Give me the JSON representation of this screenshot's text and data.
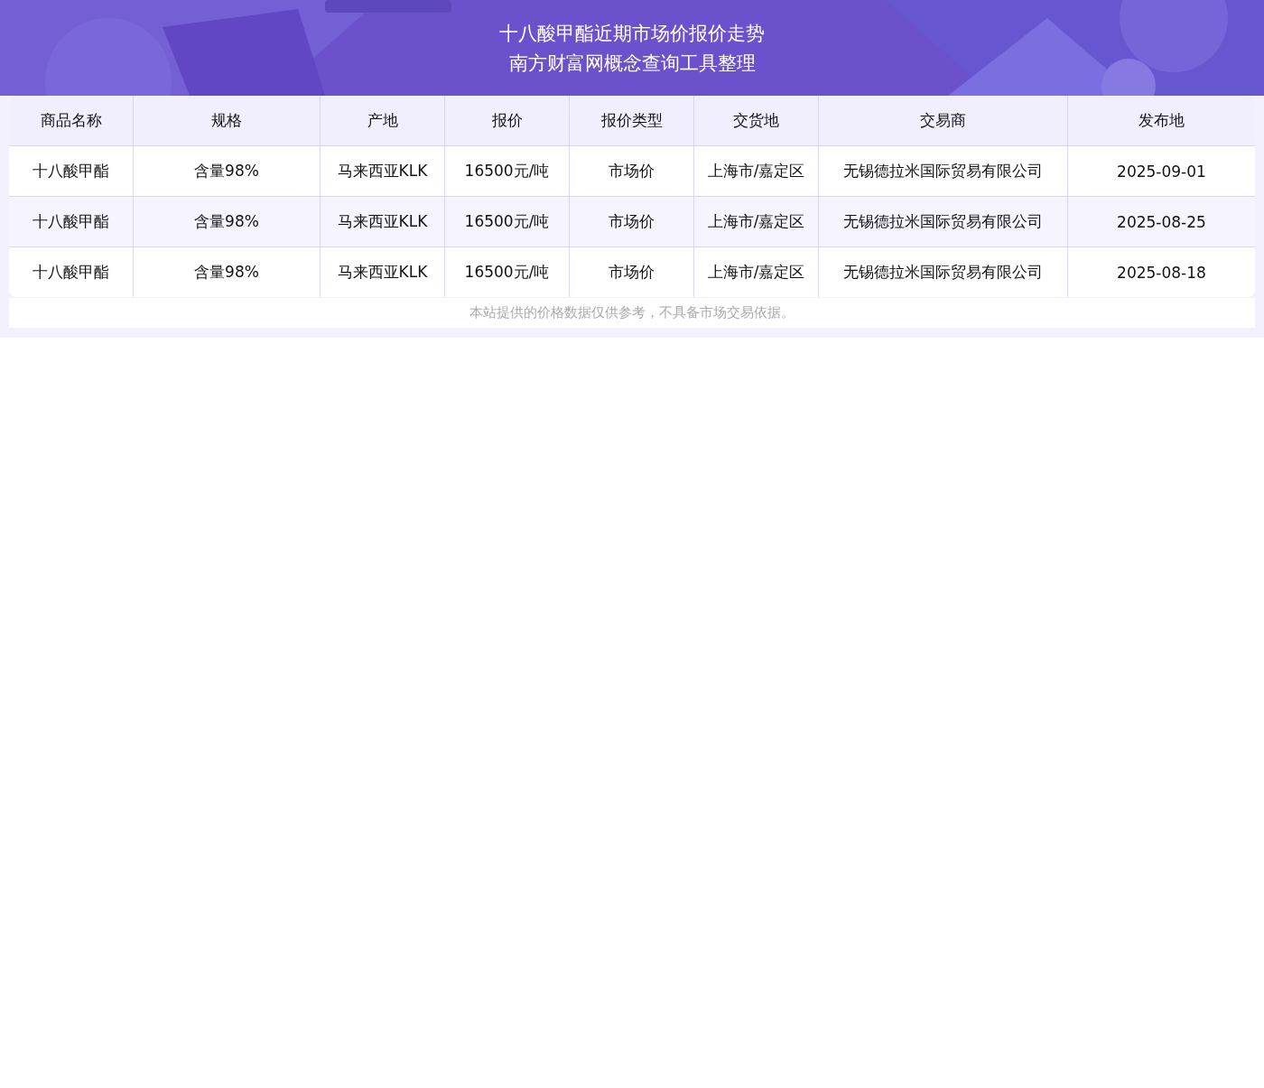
{
  "title": {
    "line1": "十八酸甲酯近期市场价报价走势",
    "line2": "南方财富网概念查询工具整理"
  },
  "table": {
    "columns": [
      "商品名称",
      "规格",
      "产地",
      "报价",
      "报价类型",
      "交货地",
      "交易商",
      "发布地"
    ],
    "rows": [
      [
        "十八酸甲酯",
        "含量98%",
        "马来西亚KLK",
        "16500元/吨",
        "市场价",
        "上海市/嘉定区",
        "无锡德拉米国际贸易有限公司",
        "2025-09-01"
      ],
      [
        "十八酸甲酯",
        "含量98%",
        "马来西亚KLK",
        "16500元/吨",
        "市场价",
        "上海市/嘉定区",
        "无锡德拉米国际贸易有限公司",
        "2025-08-25"
      ],
      [
        "十八酸甲酯",
        "含量98%",
        "马来西亚KLK",
        "16500元/吨",
        "市场价",
        "上海市/嘉定区",
        "无锡德拉米国际贸易有限公司",
        "2025-08-18"
      ]
    ]
  },
  "disclaimer": "本站提供的价格数据仅供参考，不具备市场交易依据。"
}
